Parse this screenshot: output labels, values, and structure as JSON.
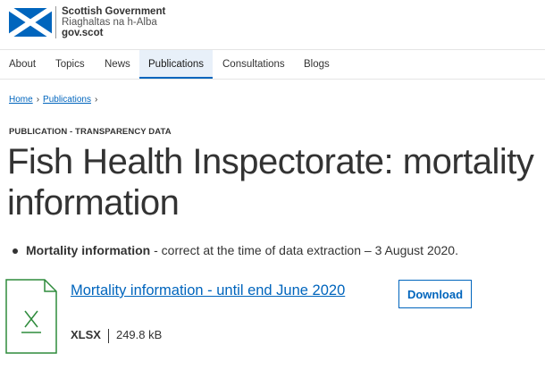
{
  "header": {
    "brand_line1": "Scottish Government",
    "brand_line2": "Riaghaltas na h-Alba",
    "brand_line3": "gov.scot"
  },
  "nav": {
    "items": [
      {
        "label": "About"
      },
      {
        "label": "Topics"
      },
      {
        "label": "News"
      },
      {
        "label": "Publications",
        "active": true
      },
      {
        "label": "Consultations"
      },
      {
        "label": "Blogs"
      }
    ]
  },
  "breadcrumb": {
    "items": [
      "Home",
      "Publications"
    ],
    "separator": "›"
  },
  "publication": {
    "type_label": "PUBLICATION - TRANSPARENCY DATA",
    "title": "Fish Health Inspectorate: mortality information",
    "bullet_bold": "Mortality information",
    "bullet_rest": " - correct at the time of data extraction – 3 August 2020."
  },
  "document": {
    "link_text": "Mortality information - until end June 2020",
    "format": "XLSX",
    "size": "249.8 kB",
    "download_label": "Download",
    "icon": "spreadsheet-file-icon"
  },
  "colors": {
    "accent": "#0065bd",
    "flag": "#0065bd",
    "file_icon": "#2e8b3c"
  }
}
